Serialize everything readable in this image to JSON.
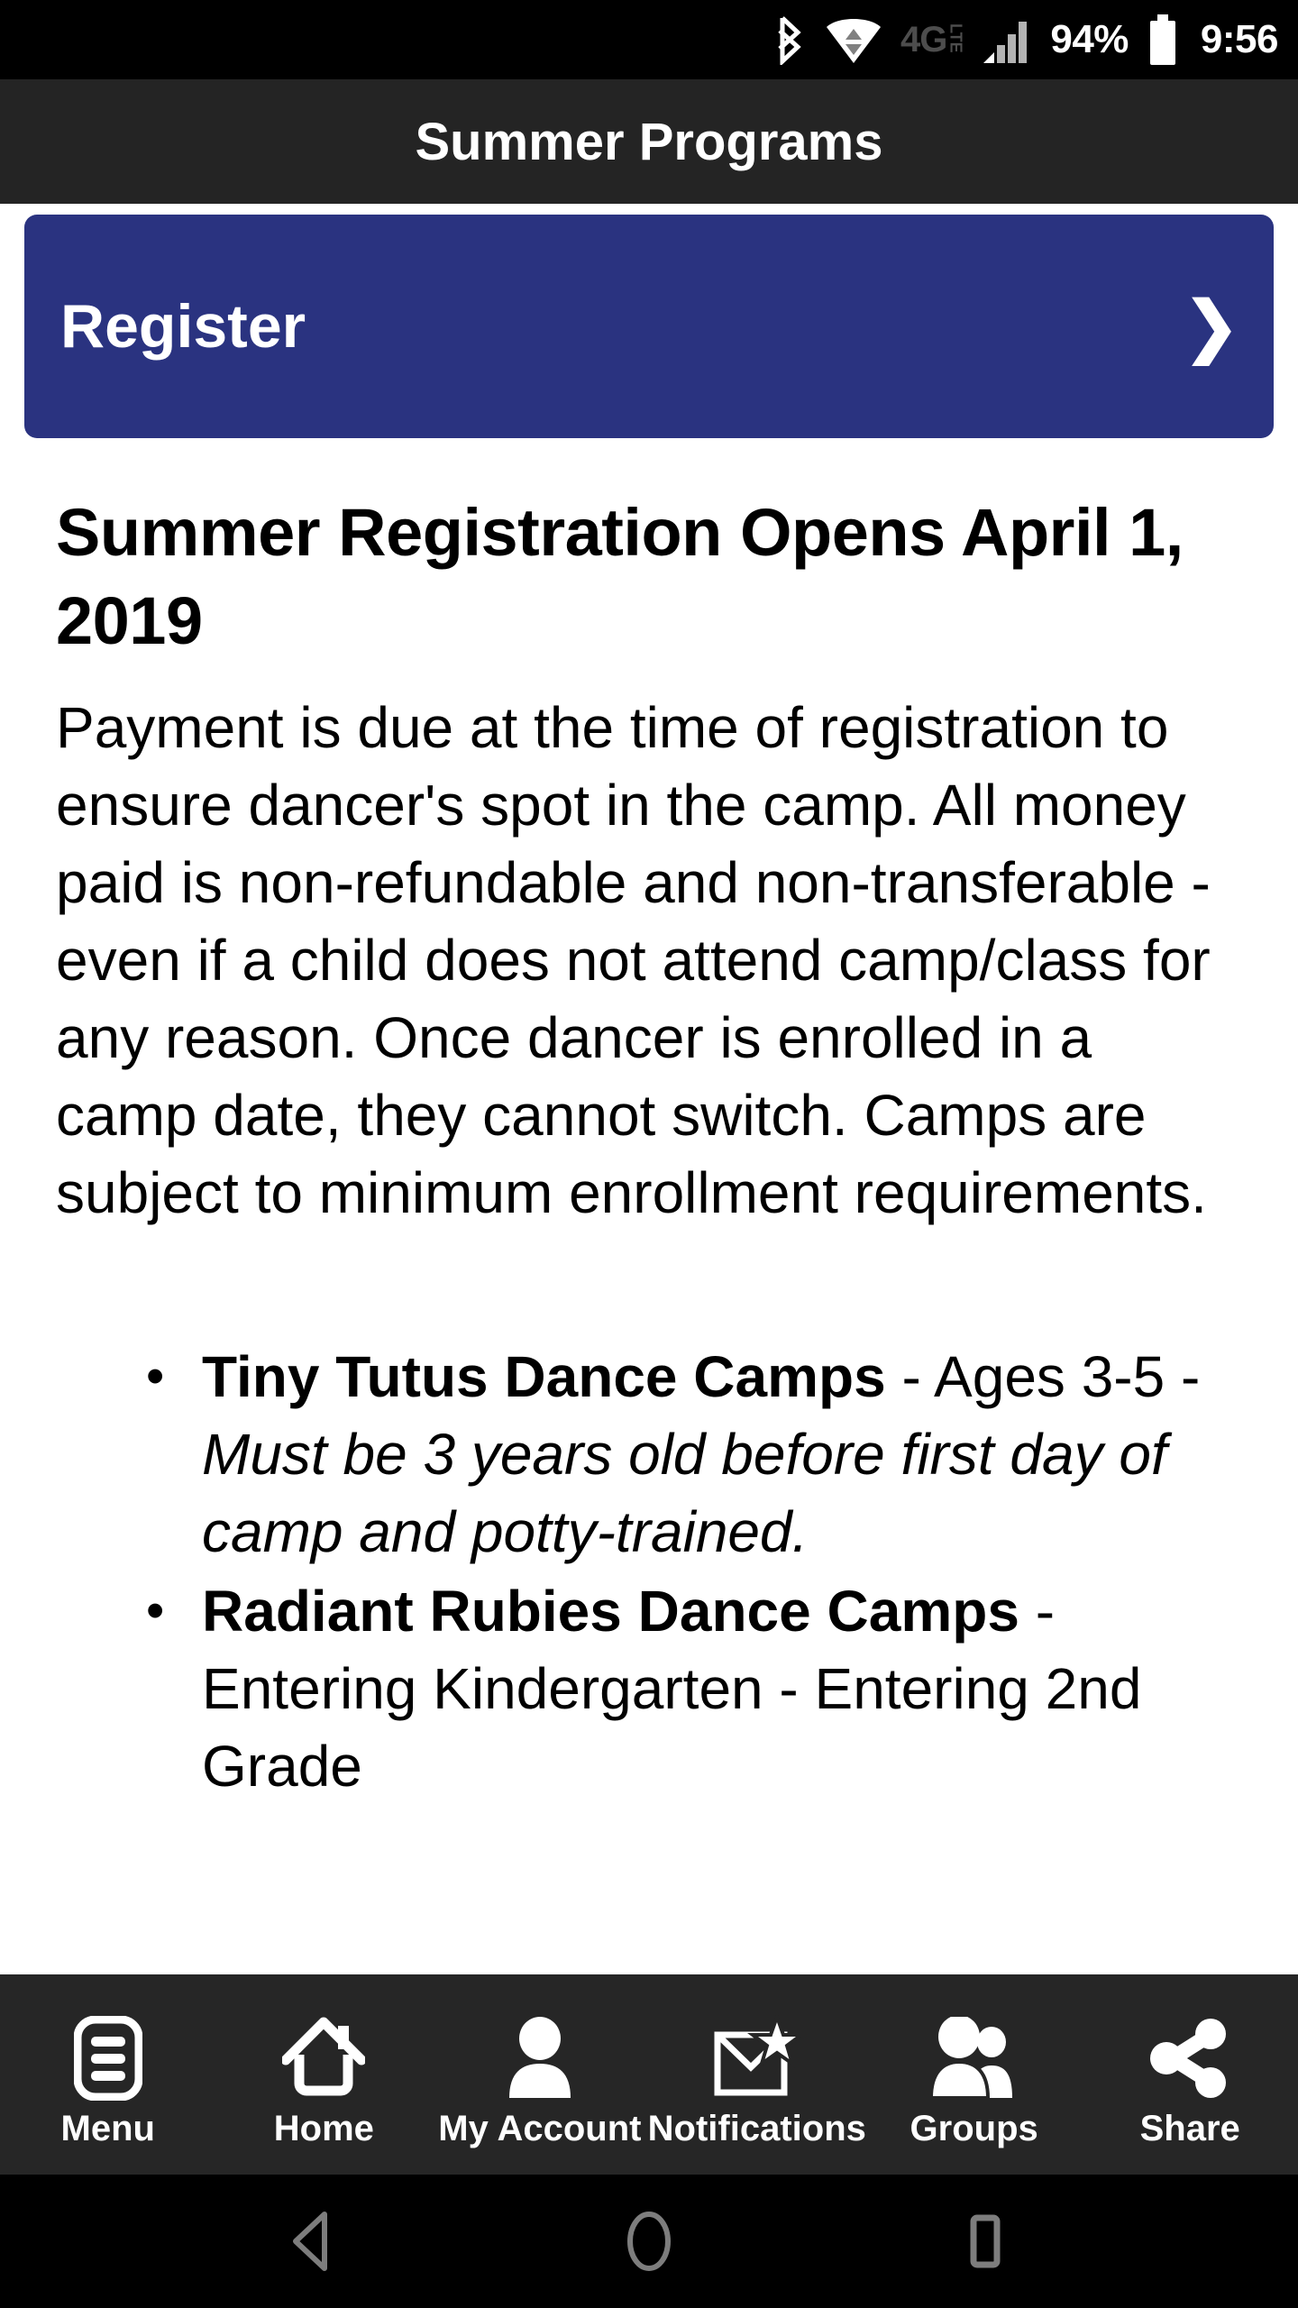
{
  "status_bar": {
    "bluetooth_icon": "bluetooth-icon",
    "wifi_icon": "wifi-icon",
    "network_type": "4G",
    "network_sub": "LTE",
    "signal_icon": "signal-bars-icon",
    "battery_percent": "94%",
    "battery_icon": "battery-icon",
    "clock": "9:56"
  },
  "header": {
    "title": "Summer Programs"
  },
  "register": {
    "label": "Register",
    "chevron": "❯"
  },
  "article": {
    "heading": "Summer Registration Opens April 1, 2019",
    "body": "Payment is due at the time of registration to ensure dancer's spot in the camp. All money paid is non-refundable and non-transferable - even if a child does not attend camp/class for any reason. Once dancer is enrolled in a camp date, they cannot switch. Camps are subject to minimum enrollment requirements.",
    "camps": [
      {
        "name": "Tiny Tutus Dance Camps",
        "detail": " - Ages 3-5 - ",
        "note": "Must be 3 years old before first day of camp and potty-trained."
      },
      {
        "name": "Radiant Rubies Dance Camps",
        "detail": " - Entering Kindergarten - Entering 2nd Grade",
        "note": ""
      }
    ]
  },
  "app_nav": {
    "items": [
      {
        "label": "Menu",
        "icon": "menu-list-icon"
      },
      {
        "label": "Home",
        "icon": "home-icon"
      },
      {
        "label": "My Account",
        "icon": "person-icon"
      },
      {
        "label": "Notifications",
        "icon": "envelope-star-icon"
      },
      {
        "label": "Groups",
        "icon": "people-group-icon"
      },
      {
        "label": "Share",
        "icon": "share-nodes-icon"
      }
    ]
  },
  "system_nav": {
    "back": "back-triangle-icon",
    "home": "home-circle-icon",
    "recents": "recents-square-icon"
  },
  "colors": {
    "accent": "#2a3380",
    "title_bar": "#242424",
    "app_nav": "#262626",
    "status_bar": "#000000",
    "page_bg": "#ffffff"
  }
}
